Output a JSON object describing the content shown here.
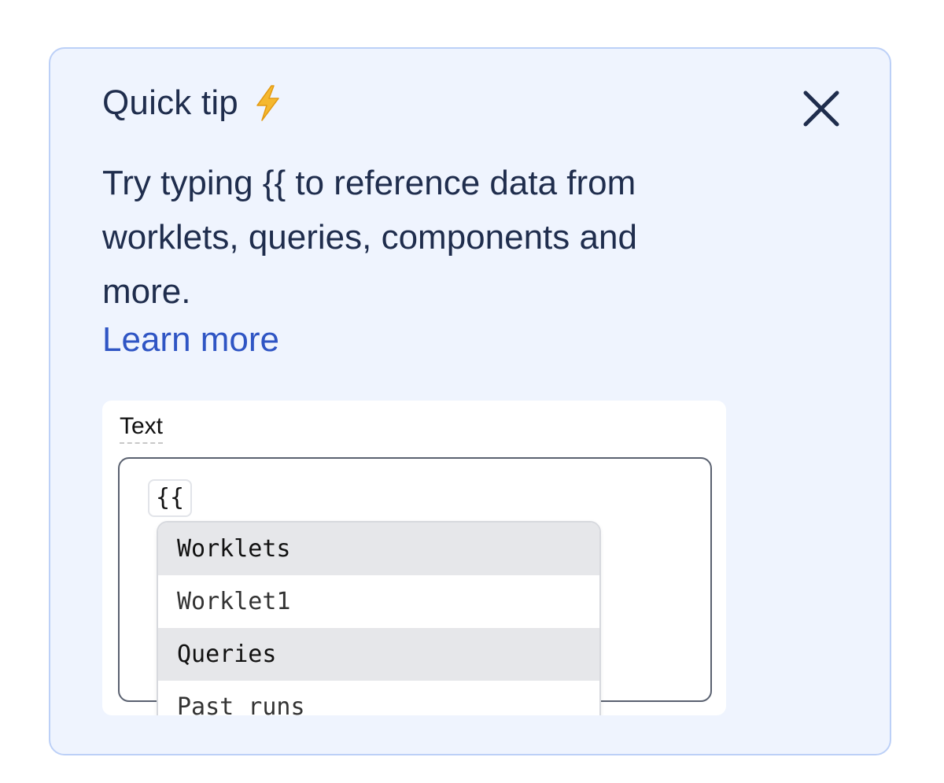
{
  "tip": {
    "title": "Quick tip",
    "title_icon": "lightning-bolt-icon",
    "close_icon": "close-icon",
    "body": "Try typing {{ to reference data from worklets, queries, components and more.",
    "learn_more": "Learn more",
    "colors": {
      "background": "#eff4fe",
      "border": "#bcd0f7",
      "text": "#1f2d4d",
      "link": "#2f55c4",
      "bolt": "#f5b82e"
    }
  },
  "preview": {
    "field_label": "Text",
    "input_value": "{{",
    "dropdown": [
      {
        "label": "Worklets",
        "kind": "group"
      },
      {
        "label": "Worklet1",
        "kind": "option"
      },
      {
        "label": "Queries",
        "kind": "group"
      },
      {
        "label": "Past runs",
        "kind": "option"
      }
    ]
  }
}
